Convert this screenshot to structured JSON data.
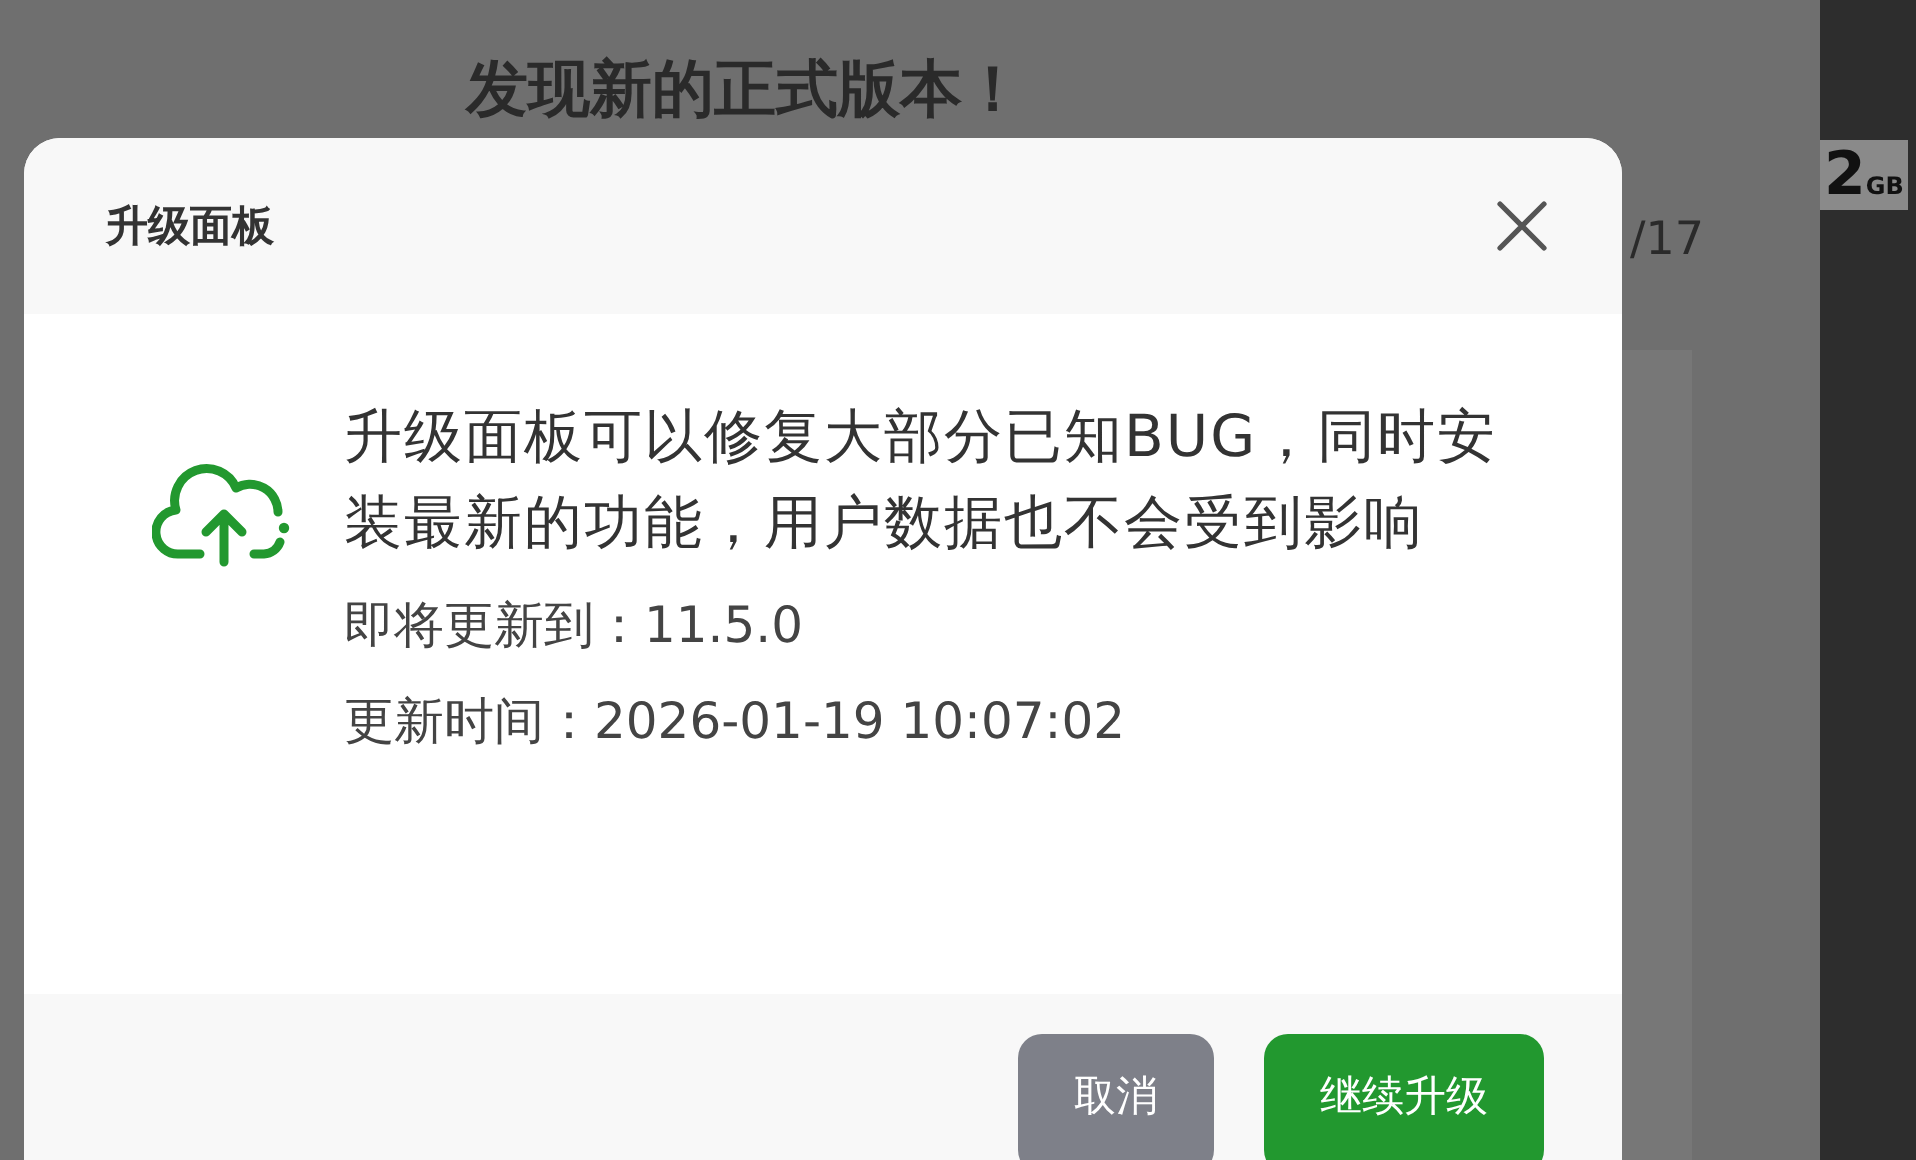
{
  "page": {
    "heading": "发现新的正式版本！",
    "count_text": "/17",
    "storage_value": "2",
    "storage_unit": "GB"
  },
  "dialog": {
    "title": "升级面板",
    "message": "升级面板可以修复大部分已知BUG，同时安装最新的功能，用户数据也不会受到影响",
    "details": [
      "即将更新到：11.5.0",
      "更新时间：2026-01-19 10:07:02"
    ],
    "buttons": [
      {
        "label": "取消",
        "kind": "secondary"
      },
      {
        "label": "继续升级",
        "kind": "primary"
      }
    ]
  }
}
